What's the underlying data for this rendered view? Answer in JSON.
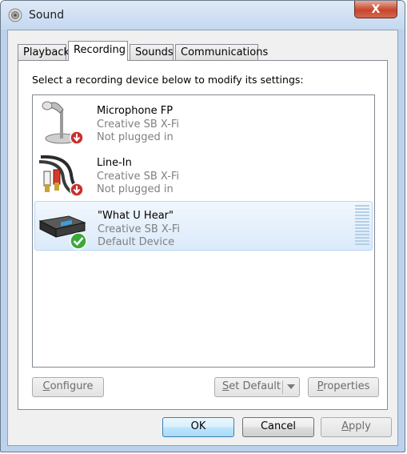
{
  "window": {
    "title": "Sound",
    "close_label": "X"
  },
  "tabs": [
    {
      "label": "Playback"
    },
    {
      "label": "Recording"
    },
    {
      "label": "Sounds"
    },
    {
      "label": "Communications"
    }
  ],
  "instruction": "Select a recording device below to modify its settings:",
  "devices": [
    {
      "name": "Microphone FP",
      "driver": "Creative SB X-Fi",
      "status": "Not plugged in",
      "icon": "microphone-icon",
      "badge": "red-down-arrow"
    },
    {
      "name": "Line-In",
      "driver": "Creative SB X-Fi",
      "status": "Not plugged in",
      "icon": "rca-cable-icon",
      "badge": "red-down-arrow"
    },
    {
      "name": "\"What U Hear\"",
      "driver": "Creative SB X-Fi",
      "status": "Default Device",
      "icon": "sound-card-icon",
      "badge": "green-check"
    }
  ],
  "buttons": {
    "configure": {
      "mn": "C",
      "rest": "onfigure"
    },
    "set_default": {
      "mn": "S",
      "rest": "et Default"
    },
    "properties": {
      "mn": "P",
      "rest": "roperties"
    },
    "ok": "OK",
    "cancel": "Cancel",
    "apply": {
      "mn": "A",
      "rest": "pply"
    }
  },
  "colors": {
    "selection": "#dbeafa",
    "accent": "#3c7fb1",
    "close": "#c6462d"
  }
}
